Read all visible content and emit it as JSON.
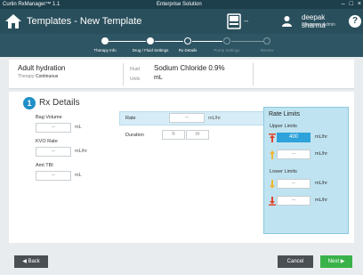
{
  "titlebar": {
    "app": "Curlin RxManager™ 1.1",
    "center": "Enterprise Solution"
  },
  "header": {
    "title": "Templates - New Template",
    "device_label": "--",
    "user_name": "deepak sharma",
    "user_role": "Pharmacy Admin",
    "help": "?"
  },
  "steps": [
    {
      "label": "Therapy Info",
      "state": "done"
    },
    {
      "label": "Drug / Fluid Settings",
      "state": "done"
    },
    {
      "label": "Rx Details",
      "state": "current"
    },
    {
      "label": "Pump Settings",
      "state": "future"
    },
    {
      "label": "Review",
      "state": "future"
    }
  ],
  "summary": {
    "rx_name": "Adult hydration",
    "therapy_label": "Therapy",
    "therapy_value": "Continuous",
    "fluid_label": "Fluid",
    "fluid_value": "Sodium Chloride 0.9%",
    "units_label": "Units",
    "units_value": "mL"
  },
  "section": {
    "number": "1",
    "title": "Rx Details"
  },
  "fields": {
    "bag_volume": {
      "label": "Bag Volume",
      "value": "--",
      "unit": "mL"
    },
    "kvo_rate": {
      "label": "KVO Rate",
      "value": "--",
      "unit": "mL/hr"
    },
    "amt_tbi": {
      "label": "Amt TBI",
      "value": "--",
      "unit": "mL"
    },
    "rate": {
      "label": "Rate",
      "value": "--",
      "unit": "mL/hr"
    },
    "duration": {
      "label": "Duration",
      "hours": "h",
      "minutes": "m"
    }
  },
  "limits": {
    "title": "Rate Limits",
    "upper_title": "Upper Limits",
    "lower_title": "Lower Limits",
    "upper_hard": {
      "value": "400",
      "unit": "mL/hr",
      "color": "#e0442c"
    },
    "upper_soft": {
      "value": "--",
      "unit": "mL/hr",
      "color": "#f2b632"
    },
    "lower_soft": {
      "value": "--",
      "unit": "mL/hr",
      "color": "#f2b632"
    },
    "lower_hard": {
      "value": "--",
      "unit": "mL/hr",
      "color": "#e0442c"
    }
  },
  "footer": {
    "back": "◀ Back",
    "cancel": "Cancel",
    "next": "Next ▶"
  },
  "colors": {
    "header": "#2a4f5c",
    "accent": "#1f8fc6",
    "next": "#3ab24a"
  }
}
